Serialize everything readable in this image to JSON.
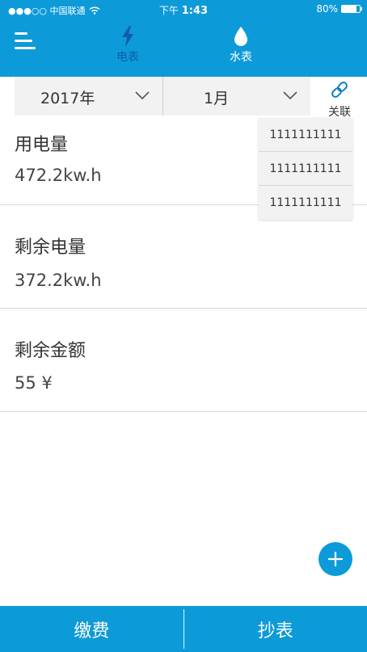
{
  "status_bar": {
    "carrier": "●●●○○ 中国联通",
    "time_prefix": "下午",
    "time": "1:43",
    "battery": "80%",
    "battery_level": 0.8
  },
  "header": {
    "tabs": [
      {
        "label": "电表",
        "icon": "lightning-icon",
        "active": true
      },
      {
        "label": "水表",
        "icon": "water-drop-icon",
        "active": false
      }
    ],
    "menu_icon": "menu-icon"
  },
  "filters": {
    "year": "2017年",
    "month": "1月",
    "link_label": "关联"
  },
  "dropdown": {
    "options": [
      "1111111111",
      "1111111111",
      "1111111111"
    ]
  },
  "metrics": [
    {
      "title": "用电量",
      "value": "472.2kw.h"
    },
    {
      "title": "剩余电量",
      "value": "372.2kw.h"
    },
    {
      "title": "剩余金额",
      "value": "55 ¥"
    }
  ],
  "bottom_bar": {
    "pay_label": "缴费",
    "read_label": "抄表"
  },
  "colors": {
    "primary": "#0d9ad8",
    "active_tab": "#0b5fa8",
    "panel": "#f2f2f2"
  }
}
